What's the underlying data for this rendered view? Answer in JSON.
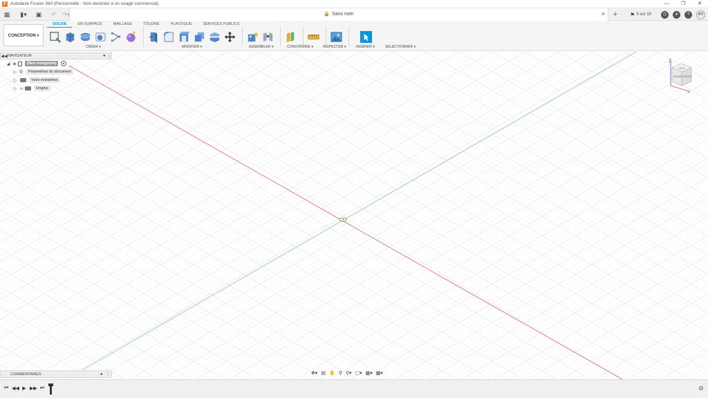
{
  "window": {
    "title": "Autodesk Fusion 360 (Personnelle - Non destinée à un usage commercial)",
    "app_icon_glyph": "F",
    "controls": [
      "minimize-icon",
      "maximize-icon",
      "close-icon"
    ]
  },
  "quick_access": {
    "icons": [
      "grid-apps-icon",
      "file-icon",
      "save-icon",
      "undo-icon",
      "redo-icon"
    ]
  },
  "document_tab": {
    "title": "Sans nom",
    "close": "×"
  },
  "status": {
    "jobs_label": "0 sur 10",
    "user_initials": "RV"
  },
  "ribbon": {
    "workspace": "CONCEPTION ▾",
    "tabs": [
      {
        "label": "SOLIDE",
        "active": true
      },
      {
        "label": "EN SURFACE",
        "active": false
      },
      {
        "label": "MAILLAGE",
        "active": false
      },
      {
        "label": "TÔLERIE",
        "active": false
      },
      {
        "label": "PLASTIQUE",
        "active": false
      },
      {
        "label": "SERVICES PUBLICS",
        "active": false
      }
    ],
    "groups": [
      "CRÉER ▾",
      "MODIFIER ▾",
      "ASSEMBLER ▾",
      "CONSTRUIRE ▾",
      "INSPECTER ▾",
      "INSÉRER ▾",
      "SÉLECTIONNER ▾"
    ]
  },
  "navigator": {
    "title": "NAVIGATEUR",
    "root_label": "(Non enregistré)",
    "items": [
      {
        "label": "Paramètres du document",
        "icon": "gear-icon"
      },
      {
        "label": "Vues existantes",
        "icon": "folder-icon"
      },
      {
        "label": "Origine",
        "icon": "folder-icon"
      }
    ]
  },
  "viewcube": {
    "z_label": "Z",
    "x_label": "X",
    "top_face": "HAUT",
    "front_face": "DEVANT",
    "right_face": "DROITE"
  },
  "comments": {
    "title": "COMMENTAIRES"
  },
  "colors": {
    "accent": "#0696d7",
    "x_axis": "#e06666",
    "y_axis": "#7ed07e",
    "grid": "#e4e4e4"
  }
}
